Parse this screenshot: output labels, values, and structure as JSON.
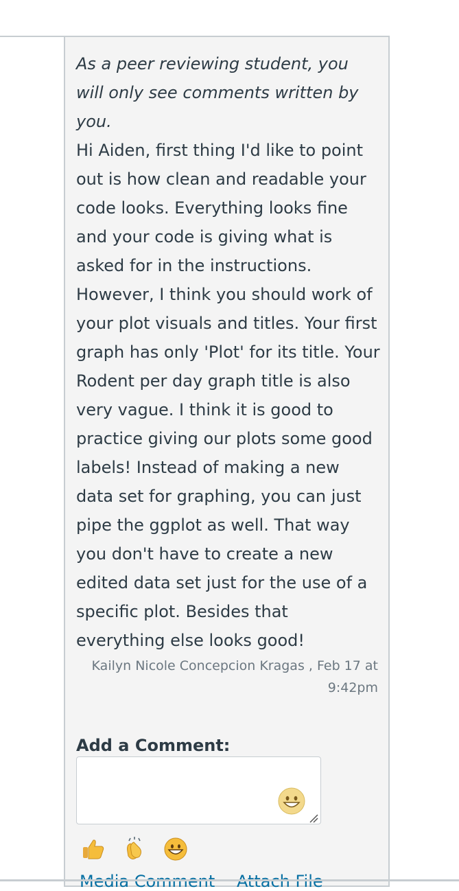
{
  "comments_panel": {
    "notice": "As a peer reviewing student, you will only see comments written by you.",
    "comment": {
      "text": "Hi Aiden, first thing I'd like to point out is how clean and readable your code looks. Everything looks fine and your code is giving what is asked for in the instructions. However, I think you should work of your plot visuals and titles. Your first graph has only 'Plot' for its title. Your Rodent per day graph title is also very vague. I think it is good to practice giving our plots some good labels!  Instead of making a new data set for graphing, you can just pipe the ggplot as well. That way you don't have to create a new edited data set just for the use of a specific plot. Besides that everything else looks good!",
      "author": "Kailyn Nicole Concepcion Kragas",
      "date": "Feb 17 at 9:42pm"
    },
    "add_comment": {
      "title": "Add a Comment:",
      "textbox_value": "",
      "emoji_button_icon": "smiley-icon",
      "reactions": [
        {
          "icon": "thumbs-up-icon"
        },
        {
          "icon": "clapping-hands-icon"
        },
        {
          "icon": "grinning-face-icon"
        }
      ],
      "links": {
        "media_comment": "Media Comment",
        "attach_file": "Attach File"
      }
    }
  },
  "colors": {
    "text": "#2d3b45",
    "meta": "#6b7780",
    "panel_bg": "#f4f4f4",
    "border": "#c7cdd1",
    "link": "#0770a3"
  }
}
